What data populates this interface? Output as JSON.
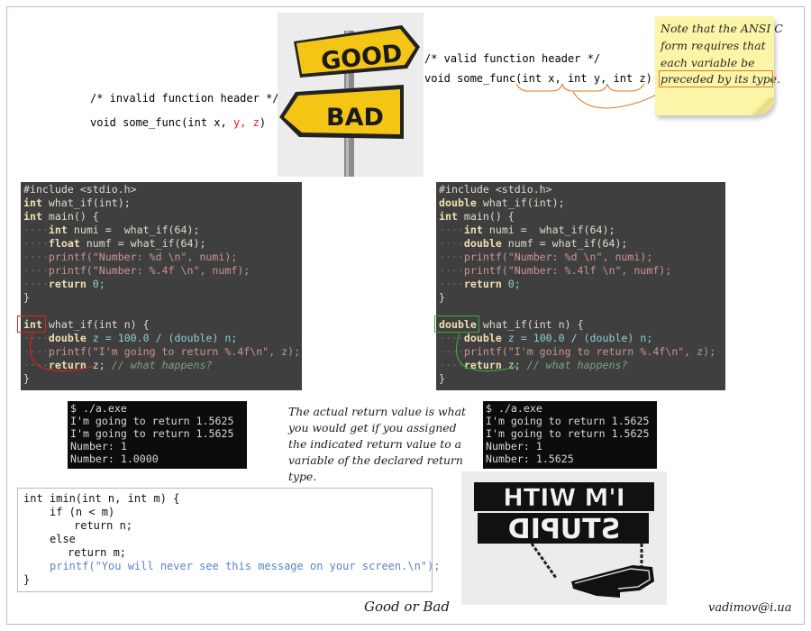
{
  "header": {
    "invalid_comment": "/* invalid function header */",
    "invalid_sig_prefix": "void some_func(int x, ",
    "invalid_sig_y": "y, z",
    "invalid_sig_suffix": ")",
    "valid_comment": "/* valid function header */",
    "valid_sig": "void some_func(int x, int y, int z)"
  },
  "signpost": {
    "good_label": "GOOD",
    "bad_label": "BAD"
  },
  "note": {
    "lines": [
      "Note that the ANSI C",
      "form requires that",
      "each variable be",
      "preceded by its type."
    ]
  },
  "left_panel": {
    "include": "#include <stdio.h>",
    "proto_type": "int",
    "proto_rest": " what_if(int);",
    "main_type": "int",
    "main_rest": " main() {",
    "l3_kw": "int",
    "l3_rest": " numi =  what_if(64);",
    "l4_kw": "float",
    "l4_rest": " numf = what_if(64);",
    "l5": "printf(\"Number: %d \\n\", numi);",
    "l6": "printf(\"Number: %.4f \\n\", numf);",
    "l7_kw": "return",
    "l7_rest": " 0;",
    "close": "}",
    "def_type": "int",
    "def_rest": " what_if(int n) {",
    "d1_kw": "double",
    "d1_rest": " z = 100.0 / (double) n;",
    "d2": "printf(\"I'm going to return %.4f\\n\", z);",
    "d3_kw": "return",
    "d3_rest": " z;",
    "d3_cmt": " // what happens?",
    "end": "}"
  },
  "right_panel": {
    "include": "#include <stdio.h>",
    "proto_type": "double",
    "proto_rest": " what_if(int);",
    "main_type": "int",
    "main_rest": " main() {",
    "l3_kw": "int",
    "l3_rest": " numi =  what_if(64);",
    "l4_kw": "double",
    "l4_rest": " numf = what_if(64);",
    "l5": "printf(\"Number: %d \\n\", numi);",
    "l6": "printf(\"Number: %.4lf \\n\", numf);",
    "l7_kw": "return",
    "l7_rest": " 0;",
    "close": "}",
    "def_type": "double",
    "def_rest": " what_if(int n) {",
    "d1_kw": "double",
    "d1_rest": " z = 100.0 / (double) n;",
    "d2": "printf(\"I'm going to return %.4f\\n\", z);",
    "d3_kw": "return",
    "d3_rest": " z;",
    "d3_cmt": " // what happens?",
    "end": "}"
  },
  "left_terminal": {
    "lines": [
      "$ ./a.exe",
      "I'm going to return 1.5625",
      "I'm going to return 1.5625",
      "Number: 1",
      "Number: 1.0000"
    ]
  },
  "right_terminal": {
    "lines": [
      "$ ./a.exe",
      "I'm going to return 1.5625",
      "I'm going to return 1.5625",
      "Number: 1",
      "Number: 1.5625"
    ]
  },
  "explain": {
    "lines": [
      "The actual return value is what",
      "you would get if you assigned",
      "the indicated return value to a",
      "variable of the declared return",
      "type."
    ]
  },
  "bottom_code": {
    "l1": "int imin(int n, int m) {",
    "l2": "if (n < m)",
    "l3": "return n;",
    "l4": "else",
    "l5": "return m;",
    "l6": "printf(\"You will never see this message on your screen.\\n\");",
    "l7": "}"
  },
  "stupid_sign": {
    "line1": "I'M WITH",
    "line2": "STUPID"
  },
  "footer": {
    "caption": "Good or Bad",
    "email": "vadimov@i.ua"
  },
  "colors": {
    "code_bg": "#3f3f3f",
    "keyword": "#f0dfaf",
    "number": "#8cd0d3",
    "string": "#cc9393",
    "comment": "#7f9f7f",
    "highlight_red": "#e0241c",
    "highlight_green": "#3cae3a",
    "highlight_orange": "#e87722",
    "sign_yellow": "#f5c516"
  }
}
